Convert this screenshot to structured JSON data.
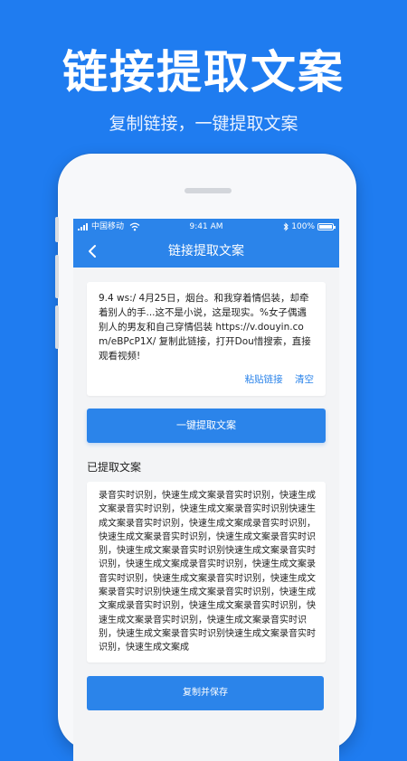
{
  "promo": {
    "title": "链接提取文案",
    "subtitle": "复制链接，一键提取文案"
  },
  "status_bar": {
    "carrier": "中国移动",
    "time": "9:41 AM",
    "battery": "100%"
  },
  "nav": {
    "title": "链接提取文案"
  },
  "input_card": {
    "text": "9.4 ws:/ 4月25日，烟台。和我穿着情侣装，却牵着别人的手...这不是小说，这是现实。%女子偶遇别人的男友和自己穿情侣装 https://v.douyin.com/eBPcP1X/ 复制此链接，打开Dou惜搜索，直接观看视频!",
    "paste_label": "粘贴链接",
    "clear_label": "清空"
  },
  "extract_button": {
    "label": "一键提取文案"
  },
  "result": {
    "section_title": "已提取文案",
    "text": "录音实时识别，快速生成文案录音实时识别，快速生成文案录音实时识别，快速生成文案录音实时识别快速生成文案录音实时识别，快速生成文案成录音实时识别，快速生成文案录音实时识别，快速生成文案录音实时识别，快速生成文案录音实时识别快速生成文案录音实时识别，快速生成文案成录音实时识别，快速生成文案录音实时识别，快速生成文案录音实时识别，快速生成文案录音实时识别快速生成文案录音实时识别，快速生成文案成录音实时识别，快速生成文案录音实时识别，快速生成文案录音实时识别，快速生成文案录音实时识别，快速生成文案录音实时识别快速生成文案录音实时识别，快速生成文案成"
  },
  "save_button": {
    "label": "复制并保存"
  },
  "colors": {
    "background": "#1f7cf0",
    "accent": "#2b84ea"
  }
}
